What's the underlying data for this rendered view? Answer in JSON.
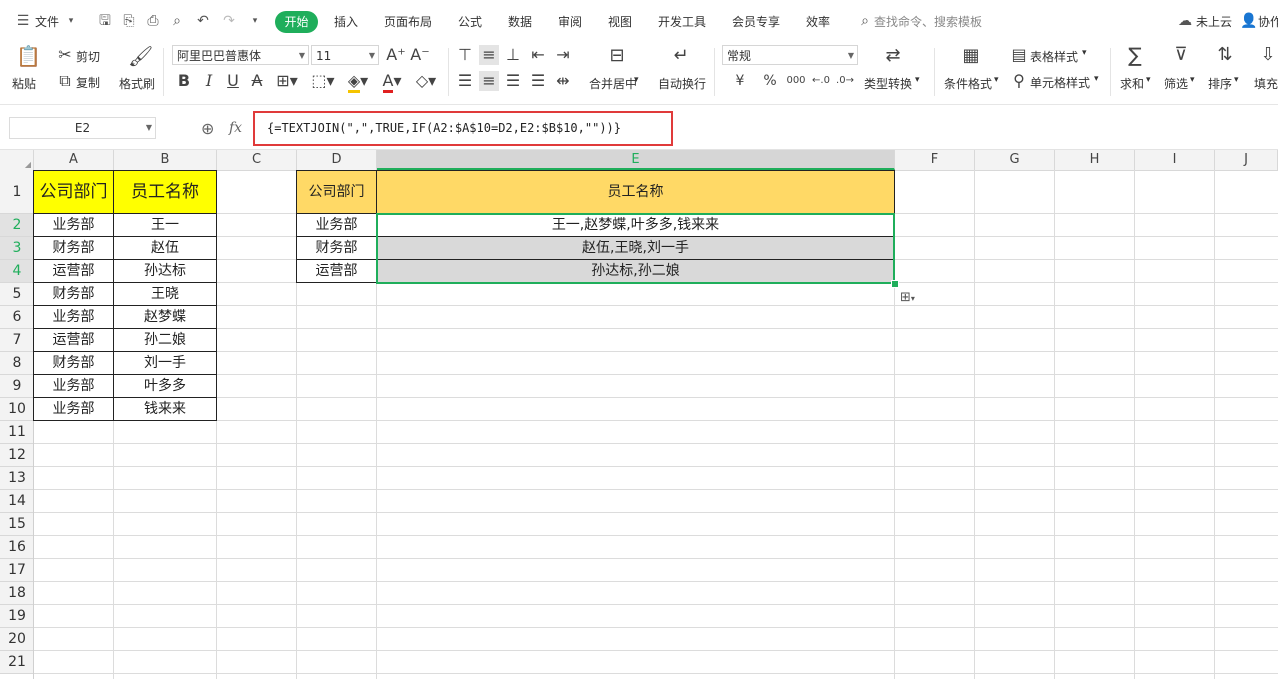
{
  "menu": {
    "file": "文件",
    "tabs": [
      "开始",
      "插入",
      "页面布局",
      "公式",
      "数据",
      "审阅",
      "视图",
      "开发工具",
      "会员专享",
      "效率"
    ],
    "search_placeholder": "查找命令、搜索模板",
    "cloud": "未上云",
    "collab": "协作"
  },
  "ribbon": {
    "paste": "粘贴",
    "cut": "剪切",
    "copy": "复制",
    "format_painter": "格式刷",
    "font_name": "阿里巴巴普惠体",
    "font_size": "11",
    "bold": "B",
    "italic": "I",
    "underline": "U",
    "merge_center": "合并居中",
    "wrap_text": "自动换行",
    "number_format": "常规",
    "currency": "¥",
    "percent": "%",
    "thousands": "000",
    "type_convert": "类型转换",
    "conditional_format": "条件格式",
    "table_style": "表格样式",
    "cell_style": "单元格样式",
    "sum": "求和",
    "filter": "筛选",
    "sort": "排序",
    "fill": "填充"
  },
  "formula_bar": {
    "cell_ref": "E2",
    "fx": "fx",
    "formula": "{=TEXTJOIN(\",\",TRUE,IF(A2:$A$10=D2,E2:$B$10,\"\"))}"
  },
  "columns": [
    "A",
    "B",
    "C",
    "D",
    "E",
    "F",
    "G",
    "H",
    "I",
    "J"
  ],
  "rows": [
    "1",
    "2",
    "3",
    "4",
    "5",
    "6",
    "7",
    "8",
    "9",
    "10",
    "11",
    "12",
    "13",
    "14",
    "15",
    "16",
    "17",
    "18",
    "19",
    "20",
    "21"
  ],
  "table_left": {
    "headers": [
      "公司部门",
      "员工名称"
    ],
    "rows": [
      [
        "业务部",
        "王一"
      ],
      [
        "财务部",
        "赵伍"
      ],
      [
        "运营部",
        "孙达标"
      ],
      [
        "财务部",
        "王晓"
      ],
      [
        "业务部",
        "赵梦蝶"
      ],
      [
        "运营部",
        "孙二娘"
      ],
      [
        "财务部",
        "刘一手"
      ],
      [
        "业务部",
        "叶多多"
      ],
      [
        "业务部",
        "钱来来"
      ]
    ]
  },
  "table_right": {
    "headers": [
      "公司部门",
      "员工名称"
    ],
    "rows": [
      [
        "业务部",
        "王一,赵梦蝶,叶多多,钱来来"
      ],
      [
        "财务部",
        "赵伍,王晓,刘一手"
      ],
      [
        "运营部",
        "孙达标,孙二娘"
      ]
    ]
  },
  "colors": {
    "accent_green": "#1fae5b",
    "header_yellow": "#ffff00",
    "header_gold": "#ffd966",
    "selection_gray": "#d9d9d9",
    "highlight_red": "#e03a3a"
  }
}
